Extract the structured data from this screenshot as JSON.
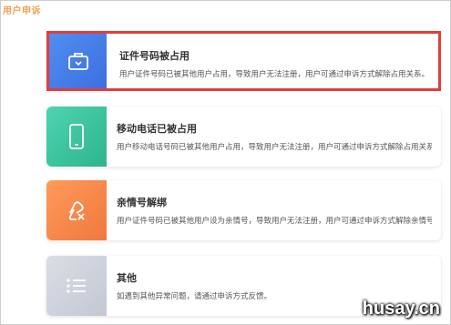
{
  "page": {
    "title": "用户申诉"
  },
  "cards": [
    {
      "title": "证件号码被占用",
      "desc": "用户证件号码已被其他用户占用，导致用户无法注册，用户可通过申诉方式解除占用关系。",
      "icon": "briefcase-icon",
      "gradient": [
        "#4f8ef0",
        "#3d6fe0"
      ],
      "selected": true
    },
    {
      "title": "移动电话已被占用",
      "desc": "用户移动电话号码已被其他用户占用，导致用户无法注册，用户可通过申诉方式解除占用关系。",
      "icon": "phone-icon",
      "gradient": [
        "#4fd3b0",
        "#2fb48f"
      ],
      "selected": false
    },
    {
      "title": "亲情号解绑",
      "desc": "用户证件号码已被其他用户设为亲情号，导致用户无法注册，用户可通过申诉方式解除亲情号关系。",
      "icon": "unlink-icon",
      "gradient": [
        "#ff9a5a",
        "#f07840"
      ],
      "selected": false
    },
    {
      "title": "其他",
      "desc": "如遇到其他异常问题，请通过申诉方式反馈。",
      "icon": "list-icon",
      "gradient": [
        "#d9dde6",
        "#c3c8d3"
      ],
      "selected": false
    }
  ],
  "watermark": "husay.cn"
}
